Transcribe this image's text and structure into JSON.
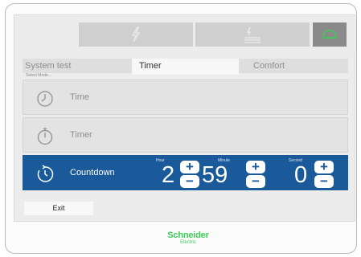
{
  "tabs": [
    {
      "label": "System test"
    },
    {
      "label": "Timer"
    },
    {
      "label": "Comfort"
    }
  ],
  "active_tab": "Timer",
  "select_mode_label": "Select Mode...",
  "modes": [
    {
      "label": "Time"
    },
    {
      "label": "Timer"
    },
    {
      "label": "Countdown"
    }
  ],
  "countdown": {
    "hour_label": "Hour",
    "minute_label": "Minute",
    "second_label": "Second",
    "hour": "2",
    "minute": "59",
    "second": "0",
    "plus": "+",
    "minus": "−"
  },
  "exit_label": "Exit",
  "brand": {
    "name": "Schneider",
    "sub": "Electric",
    "color": "#3dcd58"
  },
  "colors": {
    "selected_row": "#1a5a9a",
    "top_accent_icon": "#3dcd58"
  },
  "icons": [
    "lightning-icon",
    "heat-icon",
    "dome-icon",
    "clock-icon",
    "stopwatch-icon",
    "countdown-icon"
  ]
}
